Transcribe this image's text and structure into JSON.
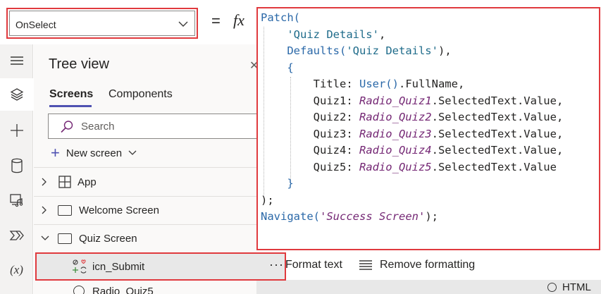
{
  "property_selector": {
    "value": "OnSelect"
  },
  "formula_bar": {
    "equals_sign": "=",
    "fx_label": "fx",
    "code_lines": [
      [
        {
          "t": "Patch(",
          "c": "fn"
        }
      ],
      [
        {
          "t": "    ",
          "c": ""
        },
        {
          "t": "'Quiz Details'",
          "c": "str"
        },
        {
          "t": ",",
          "c": ""
        }
      ],
      [
        {
          "t": "    ",
          "c": ""
        },
        {
          "t": "Defaults(",
          "c": "fn"
        },
        {
          "t": "'Quiz Details'",
          "c": "str"
        },
        {
          "t": "),",
          "c": ""
        }
      ],
      [
        {
          "t": "    ",
          "c": ""
        },
        {
          "t": "{",
          "c": "fn"
        }
      ],
      [
        {
          "t": "        Title: ",
          "c": ""
        },
        {
          "t": "User()",
          "c": "fn"
        },
        {
          "t": ".FullName,",
          "c": ""
        }
      ],
      [
        {
          "t": "        Quiz1: ",
          "c": ""
        },
        {
          "t": "Radio_Quiz1",
          "c": "ctl"
        },
        {
          "t": ".SelectedText.Value,",
          "c": ""
        }
      ],
      [
        {
          "t": "        Quiz2: ",
          "c": ""
        },
        {
          "t": "Radio_Quiz2",
          "c": "ctl"
        },
        {
          "t": ".SelectedText.Value,",
          "c": ""
        }
      ],
      [
        {
          "t": "        Quiz3: ",
          "c": ""
        },
        {
          "t": "Radio_Quiz3",
          "c": "ctl"
        },
        {
          "t": ".SelectedText.Value,",
          "c": ""
        }
      ],
      [
        {
          "t": "        Quiz4: ",
          "c": ""
        },
        {
          "t": "Radio_Quiz4",
          "c": "ctl"
        },
        {
          "t": ".SelectedText.Value,",
          "c": ""
        }
      ],
      [
        {
          "t": "        Quiz5: ",
          "c": ""
        },
        {
          "t": "Radio_Quiz5",
          "c": "ctl"
        },
        {
          "t": ".SelectedText.Value",
          "c": ""
        }
      ],
      [
        {
          "t": "    ",
          "c": ""
        },
        {
          "t": "}",
          "c": "fn"
        }
      ],
      [
        {
          "t": ");",
          "c": ""
        }
      ],
      [
        {
          "t": "Navigate(",
          "c": "fn"
        },
        {
          "t": "'Success Screen'",
          "c": "ctl"
        },
        {
          "t": ");",
          "c": ""
        }
      ]
    ],
    "format_text_label": "Format text",
    "remove_formatting_label": "Remove formatting",
    "html_label": "HTML"
  },
  "left_rail": {
    "items": [
      "menu-icon",
      "layers-icon",
      "plus-icon",
      "database-icon",
      "media-icon",
      "power-automate-icon",
      "variables-icon"
    ],
    "variables_glyph": "(x)"
  },
  "tree_view": {
    "title": "Tree view",
    "tabs": [
      "Screens",
      "Components"
    ],
    "search_placeholder": "Search",
    "new_screen_label": "New screen",
    "items": [
      {
        "label": "App",
        "expanded": false,
        "icon": "app-grid-icon"
      },
      {
        "label": "Welcome Screen",
        "expanded": false,
        "icon": "screen-icon"
      },
      {
        "label": "Quiz Screen",
        "expanded": true,
        "icon": "screen-icon"
      }
    ],
    "selected_item": {
      "label": "icn_Submit",
      "more": "···"
    },
    "partial_item": {
      "label": "Radio_Quiz5"
    }
  },
  "colors": {
    "highlight_border": "#e03a3e",
    "accent": "#4f52b2",
    "function_blue": "#2a68a8",
    "control_purple": "#742774"
  }
}
